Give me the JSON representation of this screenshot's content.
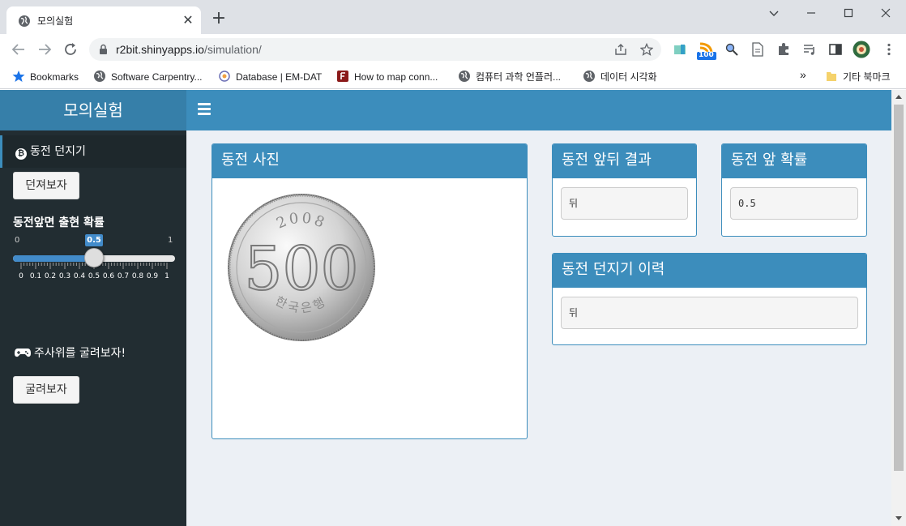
{
  "browser": {
    "tab_title": "모의실험",
    "url_host": "r2bit.shinyapps.io",
    "url_path": "/simulation/",
    "ext_badge": "100",
    "bookmarks": [
      {
        "label": "Bookmarks"
      },
      {
        "label": "Software Carpentry..."
      },
      {
        "label": "Database | EM-DAT"
      },
      {
        "label": "How to map conn..."
      },
      {
        "label": "컴퓨터 과학 언플러..."
      },
      {
        "label": "데이터 시각화"
      }
    ],
    "other_bookmarks": "기타 북마크",
    "overflow": "»"
  },
  "app": {
    "title": "모의실험",
    "sidebar": {
      "menu_item": "동전 던지기",
      "toss_button": "던져보자",
      "slider_label": "동전앞면 출현 확률",
      "slider_min": "0",
      "slider_max": "1",
      "slider_value": "0.5",
      "slider_fraction": 0.5,
      "slider_ticks": [
        "0",
        "0.1",
        "0.2",
        "0.3",
        "0.4",
        "0.5",
        "0.6",
        "0.7",
        "0.8",
        "0.9",
        "1"
      ],
      "dice_label": "주사위를 굴려보자!",
      "roll_button": "굴려보자"
    },
    "boxes": {
      "photo": {
        "title": "동전 사진",
        "coin_year": "2008",
        "coin_value": "500",
        "coin_text": "한국은행"
      },
      "result": {
        "title": "동전 앞뒤 결과",
        "value": "뒤"
      },
      "probability": {
        "title": "동전 앞 확률",
        "value": "0.5"
      },
      "history": {
        "title": "동전 던지기 이력",
        "value": "뒤"
      }
    }
  },
  "colors": {
    "header": "#3c8dbc",
    "logo": "#367fa9",
    "sidebar": "#222d32",
    "body": "#ecf0f5"
  }
}
